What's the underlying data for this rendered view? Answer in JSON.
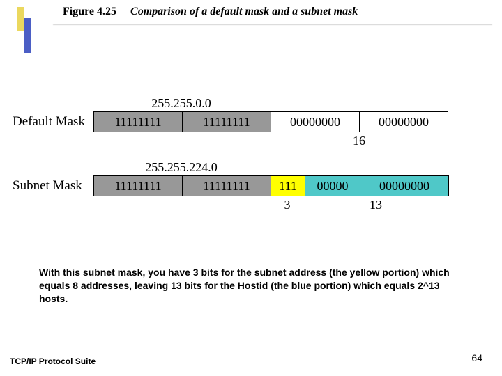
{
  "figure": {
    "number": "Figure 4.25",
    "caption": "Comparison of a default mask and a subnet mask"
  },
  "default_mask": {
    "label": "Default Mask",
    "value": "255.255.0.0",
    "bits": [
      "11111111",
      "11111111",
      "00000000",
      "00000000"
    ],
    "hostid_bits": "16"
  },
  "subnet_mask": {
    "label": "Subnet Mask",
    "value": "255.255.224.0",
    "net_bits": [
      "11111111",
      "11111111"
    ],
    "subnet_bits": "111",
    "host_bits": [
      "00000",
      "00000000"
    ],
    "subnet_count": "3",
    "host_count": "13"
  },
  "note": "With this subnet mask, you have 3 bits for the subnet address (the yellow portion) which equals 8 addresses, leaving 13 bits for the Hostid (the blue portion) which equals 2^13 hosts.",
  "footer": {
    "left": "TCP/IP Protocol Suite",
    "page": "64"
  }
}
